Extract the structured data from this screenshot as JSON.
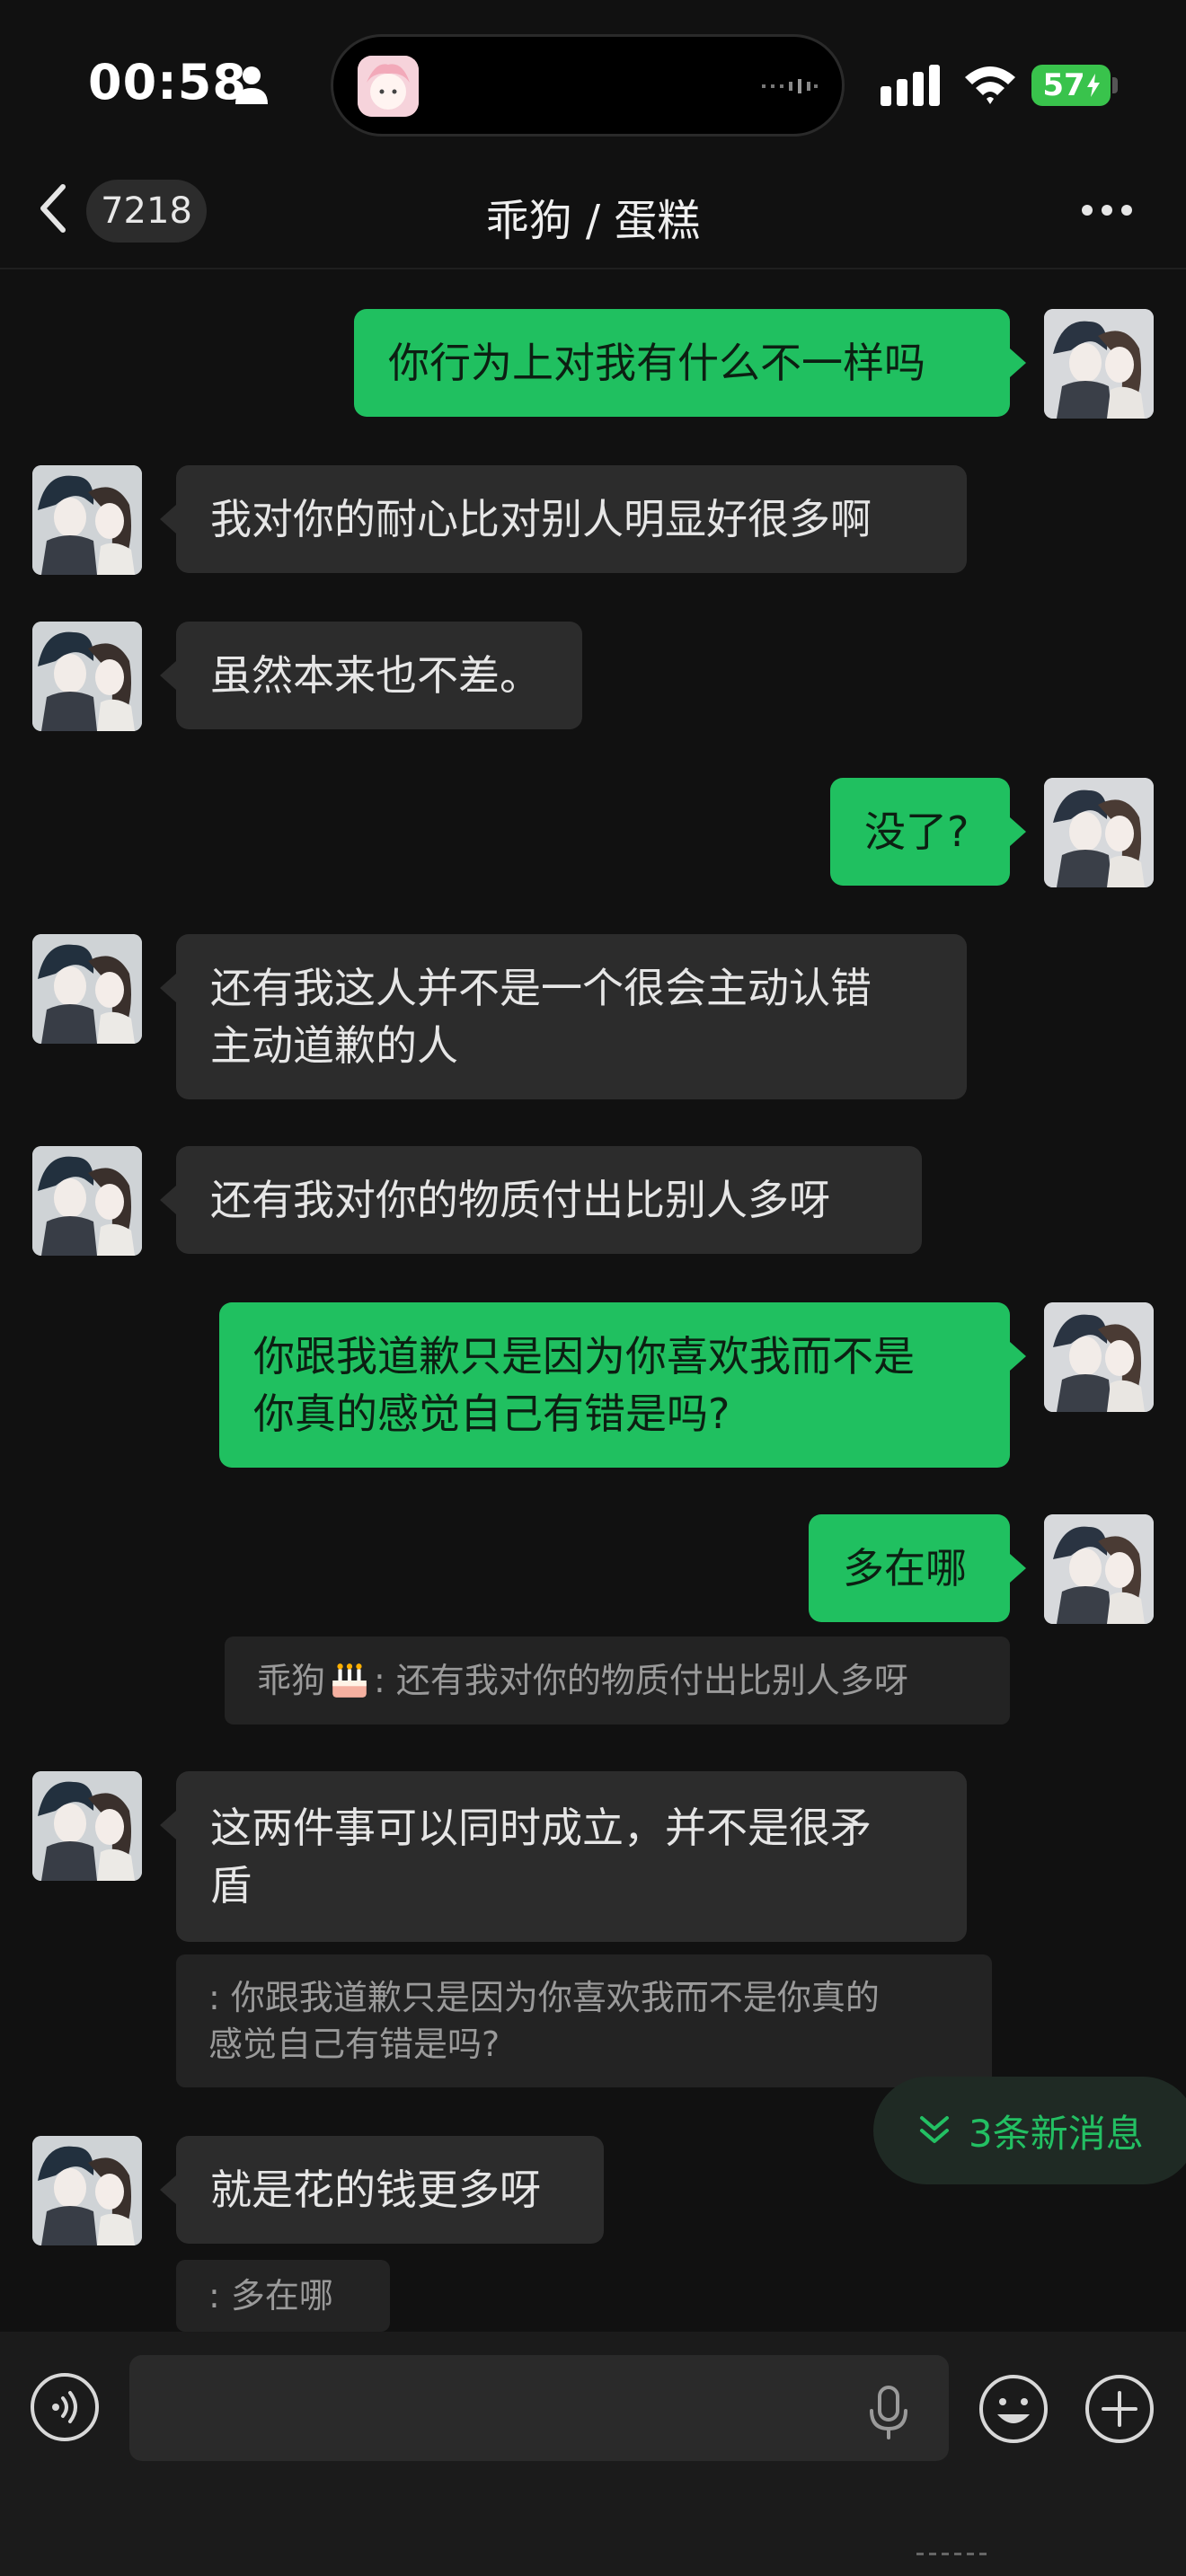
{
  "status_bar": {
    "time": "00:58",
    "battery": "57"
  },
  "header": {
    "back_count": "7218",
    "title": "乖狗 / 蛋糕"
  },
  "messages": [
    {
      "side": "out",
      "text": "你行为上对我有什么不一样吗"
    },
    {
      "side": "in",
      "text": "我对你的耐心比对别人明显好很多啊"
    },
    {
      "side": "in",
      "text": "虽然本来也不差。"
    },
    {
      "side": "out",
      "text": "没了?"
    },
    {
      "side": "in",
      "lines": [
        "还有我这人并不是一个很会主动认错",
        "主动道歉的人"
      ]
    },
    {
      "side": "in",
      "text": "还有我对你的物质付出比别人多呀"
    },
    {
      "side": "out",
      "lines": [
        "你跟我道歉只是因为你喜欢我而不是",
        "你真的感觉自己有错是吗?"
      ]
    },
    {
      "side": "out",
      "text": "多在哪"
    },
    {
      "side": "quote",
      "sender": "乖狗",
      "text": ": 还有我对你的物质付出比别人多呀"
    },
    {
      "side": "in",
      "lines": [
        "这两件事可以同时成立，并不是很矛",
        "盾"
      ]
    },
    {
      "side": "quote",
      "lines": [
        ": 你跟我道歉只是因为你喜欢我而不是你真的",
        "感觉自己有错是吗?"
      ]
    },
    {
      "side": "in",
      "text": "就是花的钱更多呀"
    },
    {
      "side": "quote",
      "text": ": 多在哪"
    }
  ],
  "new_messages_pill": "3条新消息",
  "colors": {
    "background": "#111111",
    "incoming_bubble": "#2c2c2c",
    "outgoing_bubble": "#20c060",
    "accent": "#23c063"
  },
  "icons": [
    "back-chevron-icon",
    "more-dots-icon",
    "voice-icon",
    "microphone-icon",
    "emoji-icon",
    "plus-icon",
    "double-chevron-down-icon",
    "cake-emoji-icon"
  ]
}
